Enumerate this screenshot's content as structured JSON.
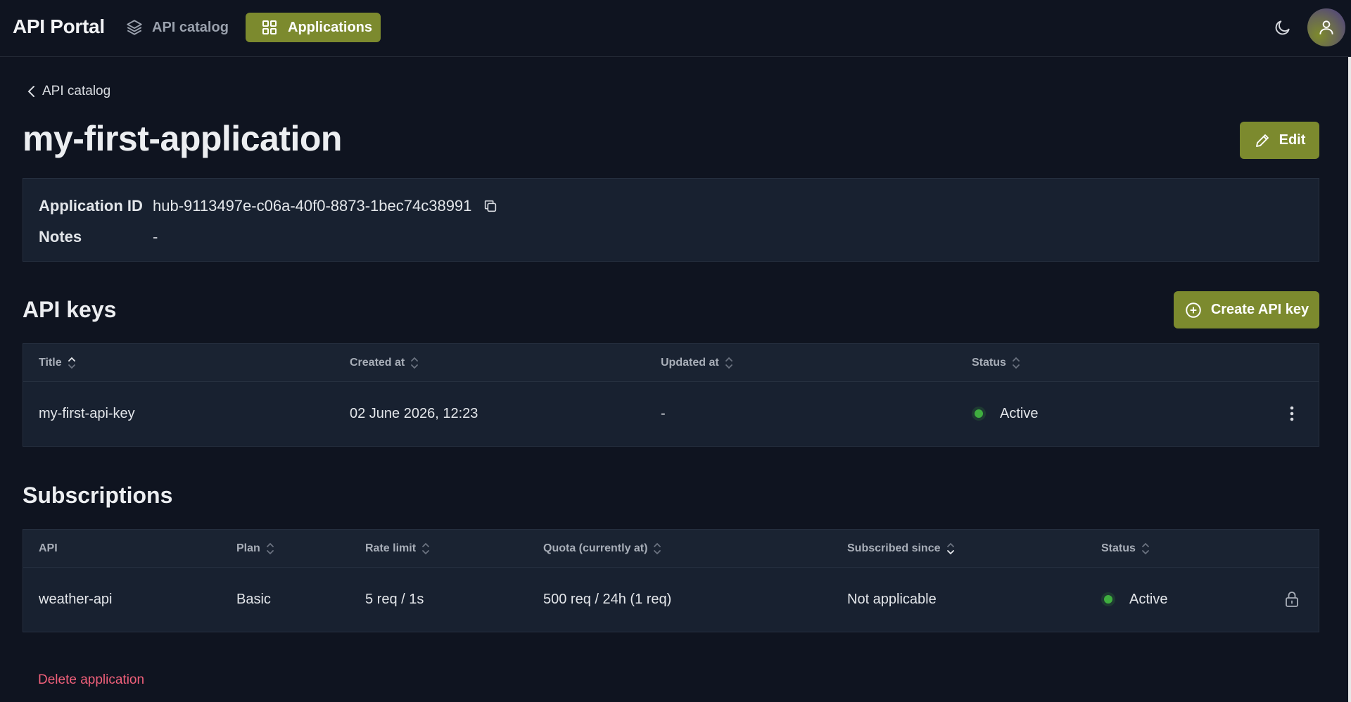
{
  "header": {
    "brand": "API Portal",
    "nav": [
      {
        "label": "API catalog",
        "icon": "layers-icon",
        "active": false
      },
      {
        "label": "Applications",
        "icon": "grid-icon",
        "active": true
      }
    ],
    "theme_icon": "moon-icon",
    "avatar_icon": "user-icon"
  },
  "breadcrumb": {
    "back_label": "API catalog"
  },
  "page": {
    "title": "my-first-application",
    "edit_label": "Edit"
  },
  "info": {
    "application_id_label": "Application ID",
    "application_id_value": "hub-9113497e-c06a-40f0-8873-1bec74c38991",
    "notes_label": "Notes",
    "notes_value": "-"
  },
  "api_keys": {
    "title": "API keys",
    "create_label": "Create API key",
    "columns": [
      "Title",
      "Created at",
      "Updated at",
      "Status"
    ],
    "rows": [
      {
        "title": "my-first-api-key",
        "created_at": "02 June 2026, 12:23",
        "updated_at": "-",
        "status": "Active"
      }
    ]
  },
  "subscriptions": {
    "title": "Subscriptions",
    "columns": [
      "API",
      "Plan",
      "Rate limit",
      "Quota (currently at)",
      "Subscribed since",
      "Status"
    ],
    "rows": [
      {
        "api": "weather-api",
        "plan": "Basic",
        "rate_limit": "5 req / 1s",
        "quota": "500 req / 24h (1 req)",
        "subscribed_since": "Not applicable",
        "status": "Active"
      }
    ]
  },
  "footer": {
    "delete_label": "Delete application"
  },
  "colors": {
    "background": "#0f1420",
    "panel": "#182130",
    "accent": "#7c8a2e",
    "status_active": "#3fae3f",
    "danger": "#f0607a"
  }
}
